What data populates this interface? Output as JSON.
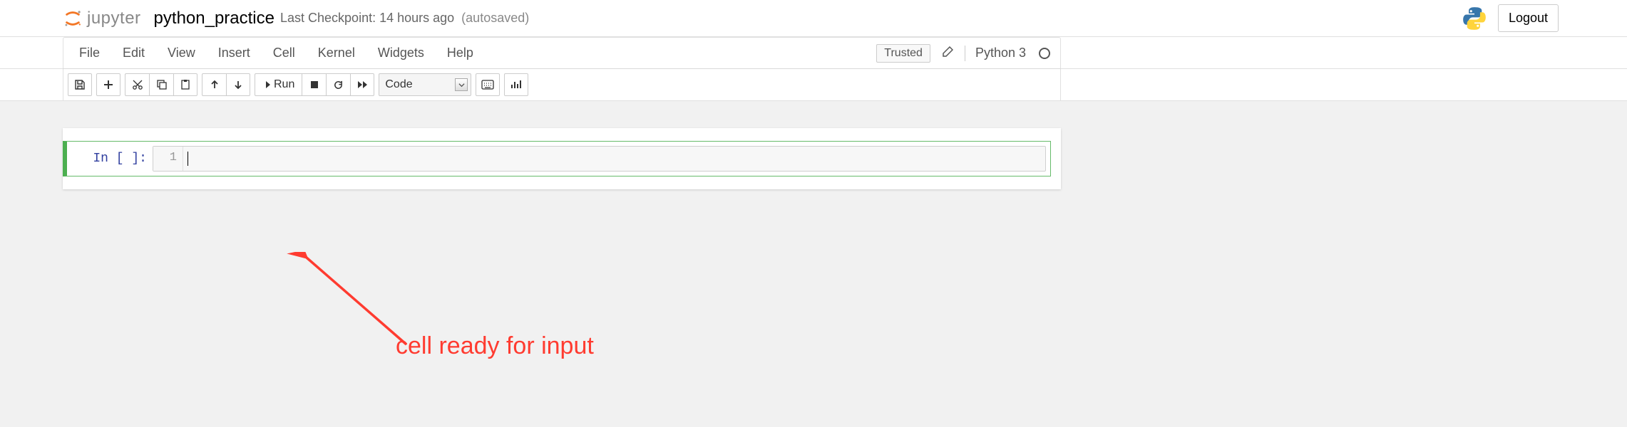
{
  "header": {
    "logo_text": "jupyter",
    "notebook_title": "python_practice",
    "checkpoint_text": "Last Checkpoint: 14 hours ago",
    "autosaved_text": "(autosaved)",
    "logout_label": "Logout"
  },
  "menubar": {
    "items": [
      "File",
      "Edit",
      "View",
      "Insert",
      "Cell",
      "Kernel",
      "Widgets",
      "Help"
    ],
    "trusted_label": "Trusted",
    "kernel_name": "Python 3"
  },
  "toolbar": {
    "run_label": "Run",
    "celltype_selected": "Code"
  },
  "cell": {
    "prompt": "In [ ]:",
    "line_number": "1",
    "content": ""
  },
  "annotation": {
    "text": "cell ready for input"
  }
}
